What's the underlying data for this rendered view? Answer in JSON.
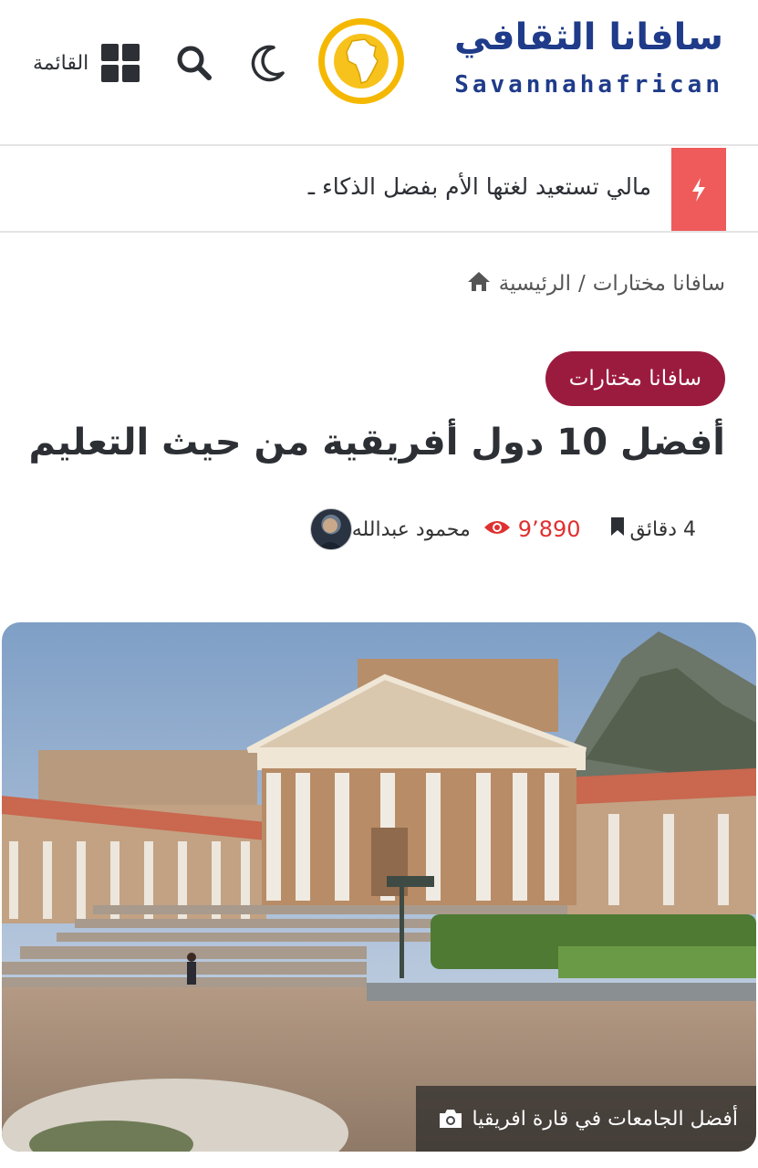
{
  "header": {
    "logo_arabic": "سافانا الثقافي",
    "logo_english": "Savannahafrican",
    "menu_label": "القائمة",
    "icons": {
      "menu": "grid-icon",
      "search": "search-icon",
      "theme": "moon-icon"
    }
  },
  "ticker": {
    "icon": "bolt-icon",
    "text": "مالي تستعيد لغتها الأم بفضل الذكاء ـ"
  },
  "breadcrumb": {
    "home": "الرئيسية",
    "separator": "/",
    "current": "سافانا مختارات"
  },
  "article": {
    "category": "سافانا مختارات",
    "title": "أفضل 10 دول أفريقية من حيث التعليم",
    "author": "محمود عبدالله",
    "views": "9٬890",
    "read_time": "4 دقائق",
    "image_caption": "أفضل الجامعات في قارة افريقيا"
  },
  "colors": {
    "brand_blue": "#1f3b8a",
    "brand_gold": "#f5b800",
    "ticker_red": "#ef5a5a",
    "category_maroon": "#9b1b3e",
    "views_red": "#e03030"
  }
}
